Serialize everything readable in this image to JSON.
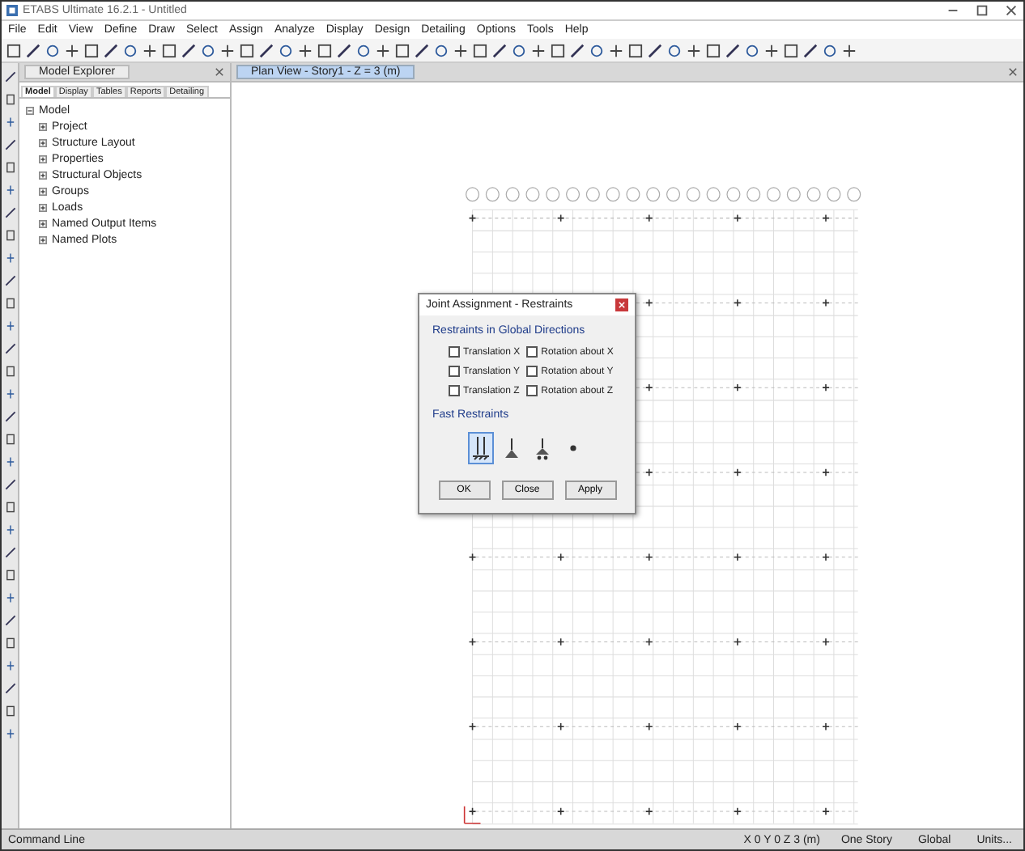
{
  "window": {
    "title": "ETABS Ultimate 16.2.1 - Untitled"
  },
  "menu": [
    "File",
    "Edit",
    "View",
    "Define",
    "Draw",
    "Select",
    "Assign",
    "Analyze",
    "Display",
    "Design",
    "Detailing",
    "Options",
    "Tools",
    "Help"
  ],
  "explorer": {
    "title": "Model Explorer",
    "tabs": [
      {
        "label": "Model",
        "selected": true
      },
      {
        "label": "Display",
        "selected": false
      },
      {
        "label": "Tables",
        "selected": false
      },
      {
        "label": "Reports",
        "selected": false
      },
      {
        "label": "Detailing",
        "selected": false
      }
    ],
    "tree": [
      {
        "label": "Model",
        "expanded": true,
        "children": [
          {
            "label": "Project"
          },
          {
            "label": "Structure Layout"
          },
          {
            "label": "Properties"
          },
          {
            "label": "Structural Objects"
          },
          {
            "label": "Groups"
          },
          {
            "label": "Loads"
          },
          {
            "label": "Named Output Items"
          },
          {
            "label": "Named Plots"
          }
        ]
      }
    ]
  },
  "view_tab": {
    "label": "Plan View - Story1 - Z = 3 (m)",
    "selected": true
  },
  "dialog": {
    "title": "Joint Assignment - Restraints",
    "group_label": "Restraints in Global Directions",
    "restraints": [
      {
        "label": "Translation X",
        "checked": false
      },
      {
        "label": "Rotation about X",
        "checked": false
      },
      {
        "label": "Translation Y",
        "checked": false
      },
      {
        "label": "Rotation about Y",
        "checked": false
      },
      {
        "label": "Translation Z",
        "checked": false
      },
      {
        "label": "Rotation about Z",
        "checked": false
      }
    ],
    "fast_label": "Fast Restraints",
    "fast": [
      {
        "kind": "fixed",
        "selected": true
      },
      {
        "kind": "pinned",
        "selected": false
      },
      {
        "kind": "roller",
        "selected": false
      },
      {
        "kind": "free",
        "selected": false
      }
    ],
    "buttons": [
      "OK",
      "Close",
      "Apply"
    ]
  },
  "status_bar": {
    "left": "Command Line",
    "coords": "X 0 Y 0 Z 3 (m)",
    "story": "One Story",
    "system": "Global",
    "units": "Units..."
  }
}
